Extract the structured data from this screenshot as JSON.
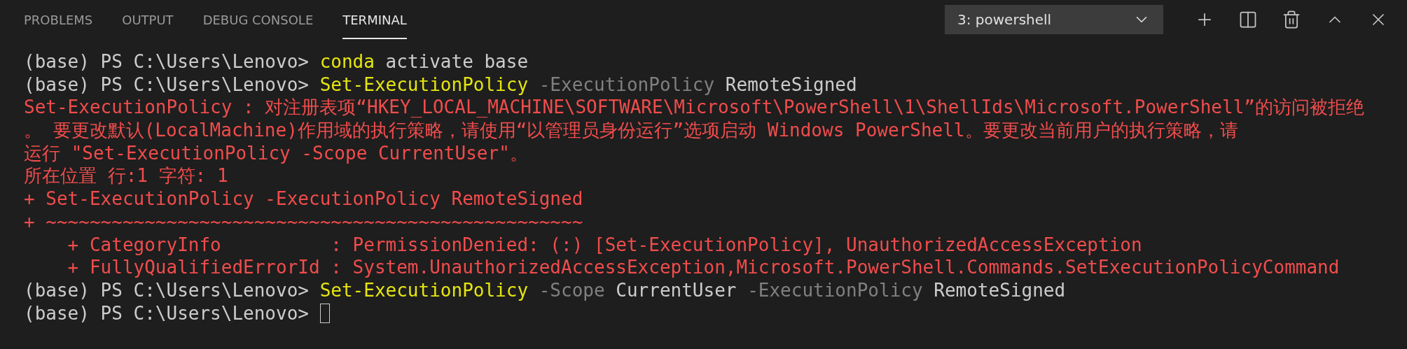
{
  "tabs": [
    {
      "label": "PROBLEMS",
      "selected": false
    },
    {
      "label": "OUTPUT",
      "selected": false
    },
    {
      "label": "DEBUG CONSOLE",
      "selected": false
    },
    {
      "label": "TERMINAL",
      "selected": true
    }
  ],
  "terminal_select": {
    "value": "3: powershell"
  },
  "lines": [
    {
      "segments": [
        {
          "kind": "prompt",
          "text": "(base) PS C:\\Users\\Lenovo> "
        },
        {
          "kind": "command",
          "text": "conda"
        },
        {
          "kind": "argument",
          "text": " activate base"
        }
      ]
    },
    {
      "segments": [
        {
          "kind": "prompt",
          "text": "(base) PS C:\\Users\\Lenovo> "
        },
        {
          "kind": "command",
          "text": "Set-ExecutionPolicy"
        },
        {
          "kind": "parameter",
          "text": " -ExecutionPolicy"
        },
        {
          "kind": "argument",
          "text": " RemoteSigned"
        }
      ]
    },
    {
      "segments": [
        {
          "kind": "error",
          "text": "Set-ExecutionPolicy : 对注册表项“HKEY_LOCAL_MACHINE\\SOFTWARE\\Microsoft\\PowerShell\\1\\ShellIds\\Microsoft.PowerShell”的访问被拒绝"
        }
      ]
    },
    {
      "segments": [
        {
          "kind": "error",
          "text": "。 要更改默认(LocalMachine)作用域的执行策略，请使用“以管理员身份运行”选项启动 Windows PowerShell。要更改当前用户的执行策略，请"
        }
      ]
    },
    {
      "segments": [
        {
          "kind": "error",
          "text": "运行 \"Set-ExecutionPolicy -Scope CurrentUser\"。"
        }
      ]
    },
    {
      "segments": [
        {
          "kind": "error",
          "text": "所在位置 行:1 字符: 1"
        }
      ]
    },
    {
      "segments": [
        {
          "kind": "error",
          "text": "+ Set-ExecutionPolicy -ExecutionPolicy RemoteSigned"
        }
      ]
    },
    {
      "segments": [
        {
          "kind": "error",
          "text": "+ ~~~~~~~~~~~~~~~~~~~~~~~~~~~~~~~~~~~~~~~~~~~~~~~~~"
        }
      ]
    },
    {
      "segments": [
        {
          "kind": "error",
          "text": "    + CategoryInfo          : PermissionDenied: (:) [Set-ExecutionPolicy], UnauthorizedAccessException"
        }
      ]
    },
    {
      "segments": [
        {
          "kind": "error",
          "text": "    + FullyQualifiedErrorId : System.UnauthorizedAccessException,Microsoft.PowerShell.Commands.SetExecutionPolicyCommand"
        }
      ]
    },
    {
      "segments": [
        {
          "kind": "prompt",
          "text": "(base) PS C:\\Users\\Lenovo> "
        },
        {
          "kind": "command",
          "text": "Set-ExecutionPolicy"
        },
        {
          "kind": "parameter",
          "text": " -Scope"
        },
        {
          "kind": "argument",
          "text": " CurrentUser"
        },
        {
          "kind": "parameter",
          "text": " -ExecutionPolicy"
        },
        {
          "kind": "argument",
          "text": " RemoteSigned"
        }
      ]
    },
    {
      "segments": [
        {
          "kind": "prompt",
          "text": "(base) PS C:\\Users\\Lenovo> "
        }
      ],
      "cursor": true
    }
  ]
}
